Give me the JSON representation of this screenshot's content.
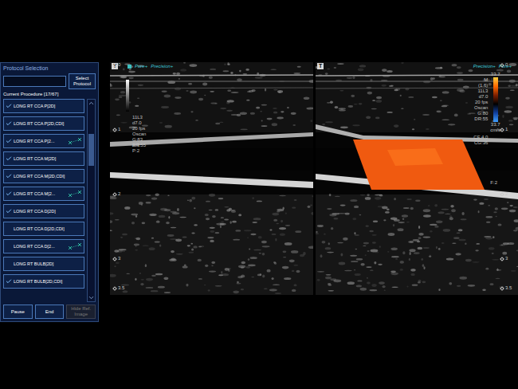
{
  "protocol_panel": {
    "title": "Protocol Selection",
    "search_value": "",
    "select_button": "Select Protocol",
    "current_procedure": "Current Procedure [17/67]",
    "items": [
      {
        "label": "LONG RT CCA P[2D]",
        "checked": true,
        "measure": false
      },
      {
        "label": "LONG RT CCA P[2D,CDI]",
        "checked": true,
        "measure": false
      },
      {
        "label": "LONG RT CCA P[2...",
        "checked": true,
        "measure": true
      },
      {
        "label": "LONG RT CCA M[2D]",
        "checked": true,
        "measure": false
      },
      {
        "label": "LONG RT CCA M[2D,CDI]",
        "checked": true,
        "measure": false
      },
      {
        "label": "LONG RT CCA M[2...",
        "checked": true,
        "measure": true
      },
      {
        "label": "LONG RT CCA D[2D]",
        "checked": true,
        "measure": false
      },
      {
        "label": "LONG RT CCA D[2D,CDI]",
        "checked": false,
        "measure": false
      },
      {
        "label": "LONG RT CCA D[2...",
        "checked": false,
        "measure": true
      },
      {
        "label": "LONG RT BULB[2D]",
        "checked": false,
        "measure": false
      },
      {
        "label": "LONG RT BULB[2D,CDI]",
        "checked": true,
        "measure": false
      }
    ],
    "buttons": [
      {
        "label": "Pause",
        "disabled": false
      },
      {
        "label": "End",
        "disabled": false
      },
      {
        "label": "Hide Ref. Image",
        "disabled": true
      }
    ]
  },
  "left_image": {
    "t_mark": "T",
    "badges": [
      "Pure+",
      "Precision+"
    ],
    "params": [
      "11L3",
      "d7.0",
      "20 fps",
      "Oscan",
      "G:83",
      "DR:55"
    ],
    "params_lower": [
      "A:3",
      "P:2"
    ],
    "depth_ticks": [
      "0",
      "1",
      "2",
      "3",
      "3.5"
    ]
  },
  "right_image": {
    "t_mark": "T",
    "badges": [
      "Precision+",
      "Pure+"
    ],
    "color_bar_top": "33.7",
    "params": [
      "M",
      "(1.6)",
      "11L3",
      "d7.0",
      "20 fps",
      "Oscan",
      "G:80",
      "DR:55"
    ],
    "color_bar_bottom": [
      "33.7",
      "cm/s"
    ],
    "params_more": [
      "CF 4.0",
      "CG:36"
    ],
    "params_lower": [
      "F:2"
    ],
    "depth_ticks": [
      "0",
      "1",
      "2",
      "3",
      "3.5"
    ],
    "color_flow": true
  }
}
